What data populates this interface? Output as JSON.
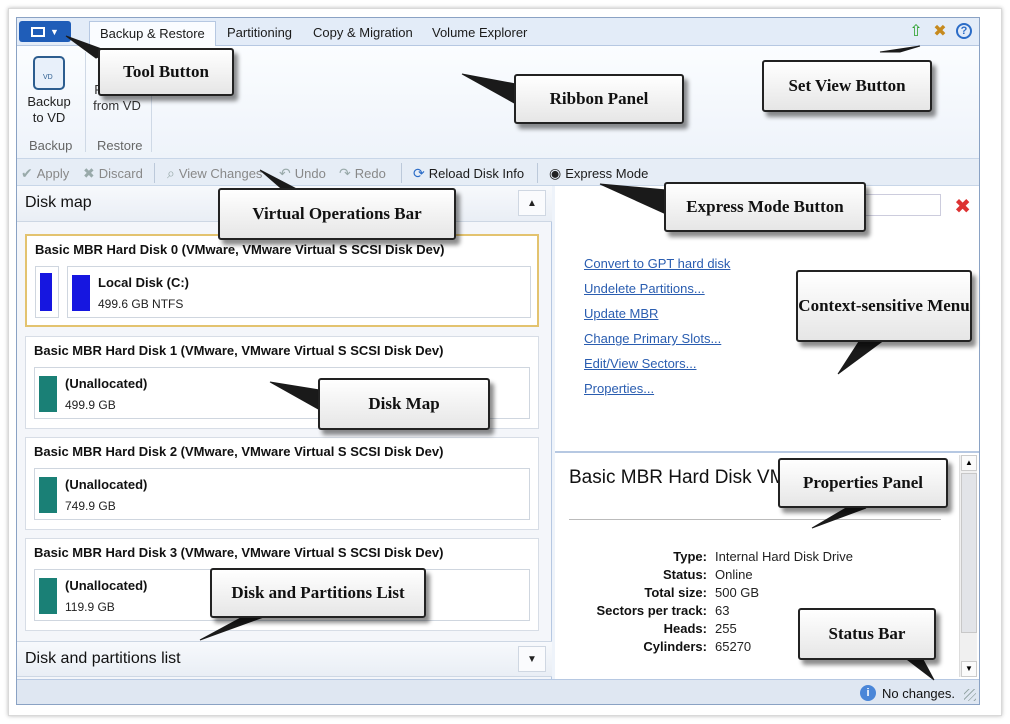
{
  "tabs": [
    "Backup & Restore",
    "Partitioning",
    "Copy & Migration",
    "Volume Explorer"
  ],
  "ribbon": {
    "backup_btn": "Backup to VD",
    "restore_btn": "Restore from VD",
    "group_backup": "Backup",
    "group_restore": "Restore"
  },
  "ops": {
    "apply": "Apply",
    "discard": "Discard",
    "view_changes": "View Changes",
    "undo": "Undo",
    "redo": "Redo",
    "reload": "Reload Disk Info",
    "express": "Express Mode"
  },
  "left": {
    "diskmap_title": "Disk map",
    "partitions_title": "Disk and partitions list",
    "disks": [
      {
        "title": "Basic MBR Hard Disk 0 (VMware, VMware Virtual S SCSI Disk Dev)",
        "part_name": "Local Disk (C:)",
        "part_size": "499.6 GB NTFS",
        "color": "#1616e0"
      },
      {
        "title": "Basic MBR Hard Disk 1 (VMware, VMware Virtual S SCSI Disk Dev)",
        "part_name": "(Unallocated)",
        "part_size": "499.9 GB",
        "color": "#1a8076"
      },
      {
        "title": "Basic MBR Hard Disk 2 (VMware, VMware Virtual S SCSI Disk Dev)",
        "part_name": "(Unallocated)",
        "part_size": "749.9 GB",
        "color": "#1a8076"
      },
      {
        "title": "Basic MBR Hard Disk 3 (VMware, VMware Virtual S SCSI Disk Dev)",
        "part_name": "(Unallocated)",
        "part_size": "119.9 GB",
        "color": "#1a8076"
      }
    ]
  },
  "context_menu": [
    "Convert to GPT hard disk",
    "Undelete Partitions...",
    "Update MBR",
    "Change Primary Slots...",
    "Edit/View Sectors...",
    "Properties..."
  ],
  "properties": {
    "title": "Basic MBR Hard Disk VMware Virtual S SCS",
    "rows": [
      {
        "k": "Type:",
        "v": "Internal Hard Disk Drive"
      },
      {
        "k": "Status:",
        "v": "Online"
      },
      {
        "k": "Total size:",
        "v": "500 GB"
      },
      {
        "k": "Sectors per track:",
        "v": "63"
      },
      {
        "k": "Heads:",
        "v": "255"
      },
      {
        "k": "Cylinders:",
        "v": "65270"
      }
    ]
  },
  "status": {
    "message": "No changes."
  },
  "callouts": {
    "tool_button": "Tool Button",
    "ribbon_panel": "Ribbon Panel",
    "set_view": "Set View Button",
    "virtual_ops": "Virtual Operations Bar",
    "express_mode": "Express Mode Button",
    "context_menu": "Context-sensitive Menu",
    "disk_map": "Disk Map",
    "properties_panel": "Properties Panel",
    "disk_partitions": "Disk and Partitions List",
    "status_bar": "Status Bar"
  },
  "icons": {
    "up": "green-up-arrow-icon",
    "tools": "tools-icon",
    "help": "help-icon"
  }
}
